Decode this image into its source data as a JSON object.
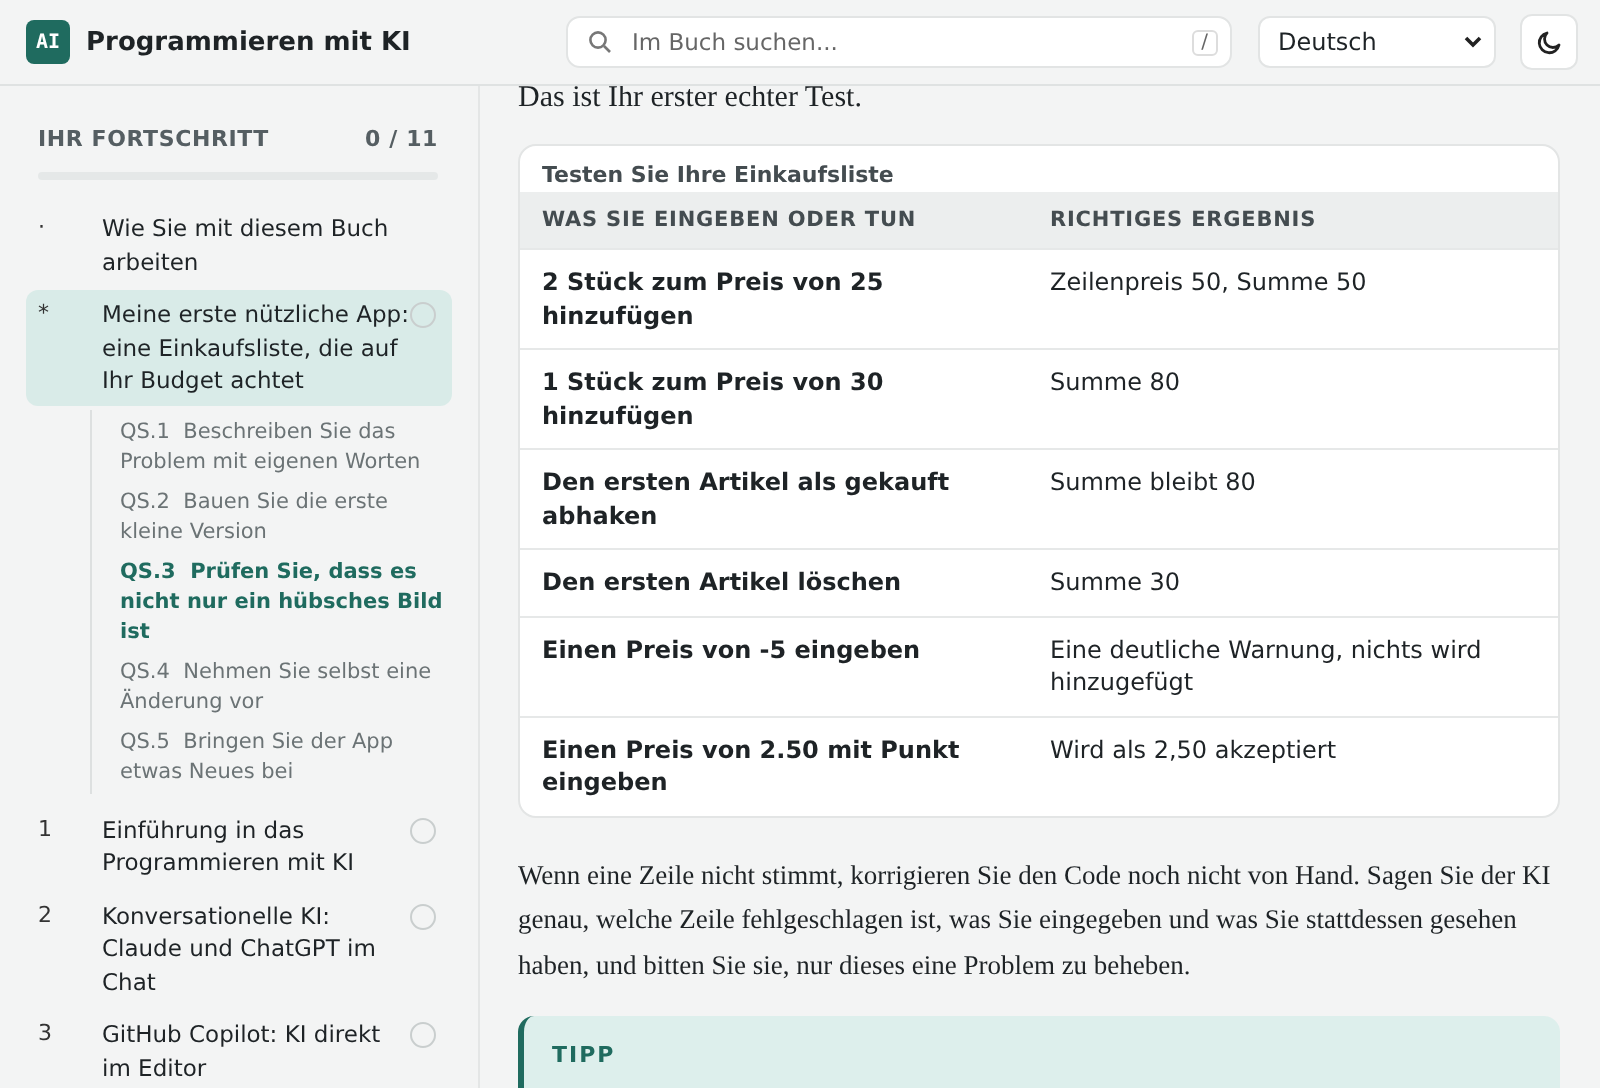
{
  "header": {
    "logo": "AI",
    "title": "Programmieren mit KI",
    "search": {
      "placeholder": "Im Buch suchen...",
      "shortcut": "/"
    },
    "language": "Deutsch"
  },
  "sidebar": {
    "progress": {
      "label": "IHR FORTSCHRITT",
      "count": "0 / 11",
      "level": 0
    },
    "items": [
      {
        "kind": "front",
        "marker": "·",
        "title": "Wie Sie mit diesem Buch arbeiten",
        "selected": false
      },
      {
        "kind": "chapter",
        "marker": "*",
        "title": "Meine erste nützliche App: eine Einkaufsliste, die auf Ihr Budget achtet",
        "selected": true,
        "done": false,
        "children": [
          {
            "number": "QS.1",
            "title": "Beschreiben Sie das Problem mit eigenen Worten",
            "selected": false
          },
          {
            "number": "QS.2",
            "title": "Bauen Sie die erste kleine Version",
            "selected": false
          },
          {
            "number": "QS.3",
            "title": "Prüfen Sie, dass es nicht nur ein hübsches Bild ist",
            "selected": true
          },
          {
            "number": "QS.4",
            "title": "Nehmen Sie selbst eine Änderung vor",
            "selected": false
          },
          {
            "number": "QS.5",
            "title": "Bringen Sie der App etwas Neues bei",
            "selected": false
          }
        ]
      },
      {
        "kind": "chapter",
        "marker": "1",
        "title": "Einführung in das Programmieren mit KI",
        "selected": false,
        "done": false
      },
      {
        "kind": "chapter",
        "marker": "2",
        "title": "Konversationelle KI: Claude und ChatGPT im Chat",
        "selected": false,
        "done": false
      },
      {
        "kind": "chapter",
        "marker": "3",
        "title": "GitHub Copilot: KI direkt im Editor",
        "selected": false,
        "done": false
      }
    ]
  },
  "content": {
    "intro": "Das ist Ihr erster echter Test.",
    "table": {
      "caption": "Testen Sie Ihre Einkaufsliste",
      "columns": [
        "WAS SIE EINGEBEN ODER TUN",
        "RICHTIGES ERGEBNIS"
      ],
      "rows": [
        [
          "2 Stück zum Preis von 25 hinzufügen",
          "Zeilenpreis 50, Summe 50"
        ],
        [
          "1 Stück zum Preis von 30 hinzufügen",
          "Summe 80"
        ],
        [
          "Den ersten Artikel als gekauft abhaken",
          "Summe bleibt 80"
        ],
        [
          "Den ersten Artikel löschen",
          "Summe 30"
        ],
        [
          "Einen Preis von -5 eingeben",
          "Eine deutliche Warnung, nichts wird hinzugefügt"
        ],
        [
          "Einen Preis von 2.50 mit Punkt eingeben",
          "Wird als 2,50 akzeptiert"
        ]
      ]
    },
    "paragraph": "Wenn eine Zeile nicht stimmt, korrigieren Sie den Code noch nicht von Hand. Sagen Sie der KI genau, welche Zeile fehlgeschlagen ist, was Sie eingegeben und was Sie stattdessen gesehen haben, und bitten Sie sie, nur dieses eine Problem zu beheben.",
    "callout": {
      "label": "TIPP"
    }
  }
}
